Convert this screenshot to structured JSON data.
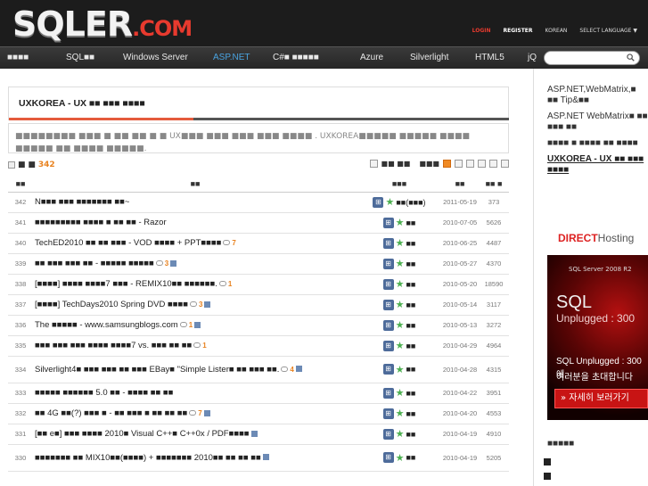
{
  "header": {
    "logo_main": "SQLER",
    "logo_dot": ".COM",
    "links": {
      "login": "LOGIN",
      "register": "REGISTER",
      "korean": "KOREAN",
      "language": "SELECT LANGUAGE ▼"
    }
  },
  "nav": {
    "items": [
      "■■■■",
      "SQL■■",
      "Windows Server",
      "ASP.NET",
      "C#■ ■■■■■",
      "Azure",
      "Silverlight",
      "HTML5",
      "jQ"
    ],
    "active": "ASP.NET",
    "search_placeholder": ""
  },
  "board": {
    "category_title": "UXKOREA - UX ■■ ■■■ ■■■■",
    "description": "■■■■■■■■ ■■■ ■ ■■ ■■ ■ ■ UX■■■ ■■■ ■■■ ■■■ ■■■■ . UXKOREA■■■■■ ■■■■■ ■■■■ ■■■■■ ■■ ■■■■ ■■■■■.",
    "total_label": "■ ■",
    "total": "342",
    "right_label": "■■ ■■",
    "right_label2": "■■■",
    "headers": {
      "no": "■■",
      "title": "■■",
      "writer": "■■■",
      "date": "■■",
      "views": "■■ ■"
    }
  },
  "posts": [
    {
      "no": "342",
      "title": "N■■■ ■■■ ■■■■■■■ ■■~",
      "comments": "",
      "attach": false,
      "writer": "■■(■■■)",
      "date": "2011-05-19",
      "views": "373"
    },
    {
      "no": "341",
      "title": "■■■■■■■■■ ■■■■ ■ ■■ ■■ - Razor",
      "comments": "",
      "attach": false,
      "writer": "■■",
      "date": "2010-07-05",
      "views": "5626"
    },
    {
      "no": "340",
      "title": "TechED2010 ■■ ■■ ■■■ - VOD ■■■■ + PPT■■■■",
      "comments": "7",
      "attach": false,
      "writer": "■■",
      "date": "2010-06-25",
      "views": "4487"
    },
    {
      "no": "339",
      "title": "■■ ■■■ ■■■ ■■ - ■■■■■ ■■■■■",
      "comments": "3",
      "attach": true,
      "writer": "■■",
      "date": "2010-05-27",
      "views": "4370"
    },
    {
      "no": "338",
      "title": "[■■■■] ■■■■ ■■■■7 ■■■ - REMIX10■■ ■■■■■■.",
      "comments": "1",
      "attach": false,
      "writer": "■■",
      "date": "2010-05-20",
      "views": "18590"
    },
    {
      "no": "337",
      "title": "[■■■■] TechDays2010 Spring DVD ■■■■",
      "comments": "3",
      "attach": true,
      "writer": "■■",
      "date": "2010-05-14",
      "views": "3117"
    },
    {
      "no": "336",
      "title": "The ■■■■■ - www.samsungblogs.com",
      "comments": "1",
      "attach": true,
      "writer": "■■",
      "date": "2010-05-13",
      "views": "3272"
    },
    {
      "no": "335",
      "title": "■■■ ■■■ ■■■ ■■■■ ■■■■7 vs. ■■■ ■■ ■■",
      "comments": "1",
      "attach": false,
      "writer": "■■",
      "date": "2010-04-29",
      "views": "4964"
    },
    {
      "no": "334",
      "title": "Silverlight4■ ■■■ ■■■ ■■ ■■■ EBay■ \"Simple Lister■ ■■ ■■■ ■■.",
      "comments": "4",
      "attach": true,
      "writer": "■■",
      "date": "2010-04-28",
      "views": "4315"
    },
    {
      "no": "333",
      "title": "■■■■■ ■■■■■■ 5.0 ■■ - ■■■■ ■■ ■■",
      "comments": "",
      "attach": false,
      "writer": "■■",
      "date": "2010-04-22",
      "views": "3951"
    },
    {
      "no": "332",
      "title": "■■ 4G ■■(?) ■■■ ■ - ■■ ■■■ ■ ■■ ■■ ■■",
      "comments": "7",
      "attach": true,
      "writer": "■■",
      "date": "2010-04-20",
      "views": "4553"
    },
    {
      "no": "331",
      "title": "[■■ e■] ■■■ ■■■■ 2010■ Visual C++■ C++0x / PDF■■■■",
      "comments": "",
      "attach": true,
      "writer": "■■",
      "date": "2010-04-19",
      "views": "4910"
    },
    {
      "no": "330",
      "title": "■■■■■■■ ■■ MIX10■■(■■■■) + ■■■■■■■ 2010■■ ■■ ■■ ■■",
      "comments": "",
      "attach": true,
      "writer": "■■",
      "date": "2010-04-19",
      "views": "5205"
    }
  ],
  "sidebar": {
    "links": [
      "ASP.NET,WebMatrix,■ ■■ Tip&■■",
      "ASP.NET WebMatrix■ ■■ ■■■ ■■",
      "■■■■ ■ ■■■■ ■■ ■■■■",
      "UXKOREA - UX ■■ ■■■ ■■■■"
    ],
    "bottom_label": "■■■■■"
  },
  "ad": {
    "brand1": "DIRECT",
    "brand2": "Hosting",
    "sqlserver": "SQL Server 2008 R2",
    "big": "SQL",
    "unplugged": "Unplugged : 300",
    "line1": "SQL Unplugged : 300에",
    "line2": "여러분을 초대합니다",
    "button": "» 자세히 보러가기"
  },
  "colors": {
    "accent": "#e55b3c",
    "nav_active": "#4aa3e0",
    "count": "#e8821f"
  }
}
